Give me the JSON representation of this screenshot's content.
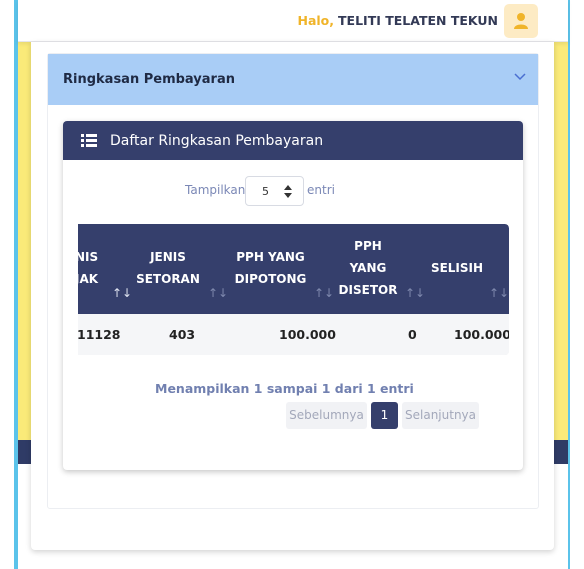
{
  "header": {
    "greeting": "Halo,",
    "user_name": "TELITI TELATEN TEKUN",
    "avatar_icon": "user-icon"
  },
  "accordion": {
    "title": "Ringkasan Pembayaran",
    "toggle_icon": "chevron-down-icon"
  },
  "list": {
    "title": "Daftar Ringkasan Pembayaran",
    "icon": "list-icon",
    "length_label": "Tampilkan",
    "length_value": "5",
    "length_suffix": "entri"
  },
  "table": {
    "columns": [
      {
        "line1": "NIS",
        "line2": "JAK",
        "line3": ""
      },
      {
        "line1": "JENIS",
        "line2": "SETORAN",
        "line3": ""
      },
      {
        "line1": "PPH YANG",
        "line2": "DIPOTONG",
        "line3": ""
      },
      {
        "line1": "PPH",
        "line2": "YANG",
        "line3": "DISETOR"
      },
      {
        "line1": "SELISIH",
        "line2": "",
        "line3": ""
      }
    ],
    "rows": [
      [
        "11128",
        "403",
        "100.000",
        "0",
        "100.000"
      ]
    ]
  },
  "footer": {
    "info": "Menampilkan 1 sampai 1 dari 1 entri",
    "prev": "Sebelumnya",
    "page": "1",
    "next": "Selanjutnya"
  },
  "colors": {
    "navy": "#353f6c",
    "accordion_bg": "#a9cdf6",
    "greeting_accent": "#f0b429",
    "background_yellow": "#f3dc3e",
    "frame_blue": "#5bc3ea"
  }
}
